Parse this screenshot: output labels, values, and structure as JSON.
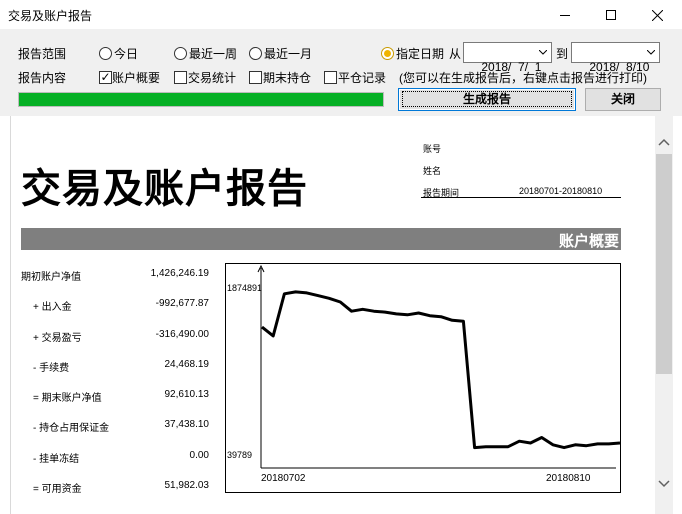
{
  "window": {
    "title": "交易及账户报告"
  },
  "toolbar": {
    "range_label": "报告范围",
    "range_options": [
      "今日",
      "最近一周",
      "最近一月",
      "指定日期"
    ],
    "range_selected": "指定日期",
    "from_label": "从",
    "from_date": "2018/  7/  1",
    "to_label": "到",
    "to_date": "2018/  8/10",
    "content_label": "报告内容",
    "content_options": [
      {
        "label": "账户概要",
        "checked": true
      },
      {
        "label": "交易统计",
        "checked": false
      },
      {
        "label": "期末持仓",
        "checked": false
      },
      {
        "label": "平仓记录",
        "checked": false
      }
    ],
    "hint": "(您可以在生成报告后，右键点击报告进行打印)",
    "progress": 1.0,
    "generate_label": "生成报告",
    "close_label": "关闭"
  },
  "report": {
    "title": "交易及账户报告",
    "account_label": "账号",
    "name_label": "姓名",
    "period_label": "报告期间",
    "period_value": "20180701-20180810",
    "section_title": "账户概要",
    "rows": [
      {
        "label": "期初账户净值",
        "value": "1,426,246.19"
      },
      {
        "label": "+ 出入金",
        "value": "-992,677.87"
      },
      {
        "label": "+ 交易盈亏",
        "value": "-316,490.00"
      },
      {
        "label": "- 手续费",
        "value": "24,468.19"
      },
      {
        "label": "= 期末账户净值",
        "value": "92,610.13"
      },
      {
        "label": "- 持仓占用保证金",
        "value": "37,438.10"
      },
      {
        "label": "- 挂单冻结",
        "value": "0.00"
      },
      {
        "label": "= 可用资金",
        "value": "51,982.03"
      }
    ]
  },
  "chart_data": {
    "type": "line",
    "x_start_label": "20180702",
    "x_end_label": "20180810",
    "y_max_label": "1874891",
    "y_min_label": "39789",
    "ylim": [
      39789,
      1874891
    ],
    "series": [
      {
        "values": [
          1426246,
          1330000,
          1790000,
          1810000,
          1800000,
          1770000,
          1740000,
          1700000,
          1600000,
          1620000,
          1600000,
          1590000,
          1570000,
          1560000,
          1580000,
          1550000,
          1540000,
          1500000,
          1490000,
          110000,
          120000,
          120000,
          120000,
          180000,
          160000,
          220000,
          140000,
          110000,
          140000,
          130000,
          150000,
          150000,
          160000
        ]
      }
    ]
  }
}
